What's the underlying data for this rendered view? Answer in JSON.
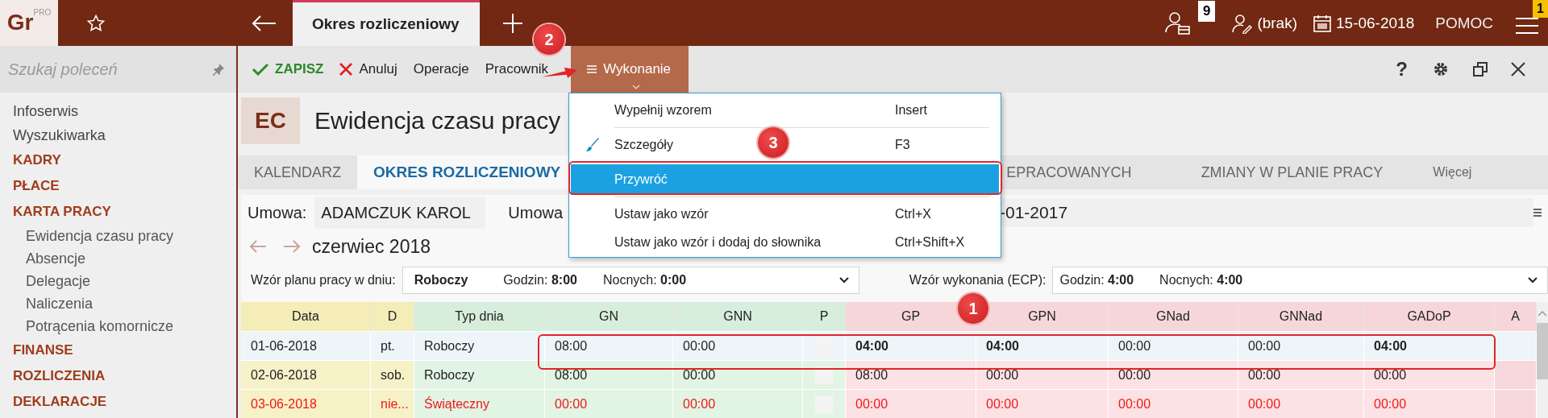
{
  "app": {
    "logo": "Gr",
    "logo_badge": "PRO"
  },
  "top_tabs": [
    {
      "label": "Okres rozliczeniowy",
      "selected": true
    }
  ],
  "top_right": {
    "notifications_badge": "9",
    "user": "(brak)",
    "date": "15-06-2018",
    "help": "POMOC",
    "menu_badge": "1"
  },
  "sidebar": {
    "search_placeholder": "Szukaj poleceń",
    "items": [
      {
        "label": "Infoserwis",
        "kind": "link"
      },
      {
        "label": "Wyszukiwarka",
        "kind": "link"
      },
      {
        "label": "KADRY",
        "kind": "section"
      },
      {
        "label": "PŁACE",
        "kind": "section"
      },
      {
        "label": "KARTA PRACY",
        "kind": "section",
        "children": [
          {
            "label": "Ewidencja czasu pracy"
          },
          {
            "label": "Absencje"
          },
          {
            "label": "Delegacje"
          },
          {
            "label": "Naliczenia"
          },
          {
            "label": "Potrącenia komornicze"
          }
        ]
      },
      {
        "label": "FINANSE",
        "kind": "section"
      },
      {
        "label": "ROZLICZENIA",
        "kind": "section"
      },
      {
        "label": "DEKLARACJE",
        "kind": "section"
      }
    ]
  },
  "toolbar": {
    "buttons": [
      {
        "label": "ZAPISZ",
        "kind": "save"
      },
      {
        "label": "Anuluj",
        "kind": "cancel"
      },
      {
        "label": "Operacje",
        "kind": "plain"
      },
      {
        "label": "Pracownik",
        "kind": "plain"
      },
      {
        "label": "Wykonanie",
        "kind": "menu",
        "expanded": true
      }
    ],
    "help": "?"
  },
  "dropdown": {
    "items": [
      {
        "label": "Wypełnij wzorem",
        "shortcut": "Insert",
        "kind": "plain",
        "selected": false,
        "separator_after": true
      },
      {
        "label": "Szczegóły",
        "shortcut": "F3",
        "kind": "brush",
        "selected": false,
        "separator_after": true
      },
      {
        "label": "Przywróć",
        "kind": "plain",
        "selected": true,
        "separator_after": true
      },
      {
        "label": "Ustaw jako wzór",
        "shortcut": "Ctrl+X",
        "kind": "plain",
        "selected": false,
        "separator_after": false
      },
      {
        "label": "Ustaw jako wzór i dodaj do słownika",
        "shortcut": "Ctrl+Shift+X",
        "kind": "plain",
        "selected": false,
        "separator_after": false
      }
    ]
  },
  "module": {
    "badge": "EC",
    "title": "Ewidencja czasu pracy"
  },
  "tabs": [
    {
      "label": "KALENDARZ",
      "kind": "tab",
      "selected": false
    },
    {
      "label": "OKRES ROZLICZENIOWY",
      "kind": "tab",
      "selected": true
    },
    {
      "label": "EPRACOWANYCH",
      "kind": "partial",
      "selected": false
    },
    {
      "label": "ZMIANY W PLANIE PRACY",
      "kind": "tab",
      "selected": false
    },
    {
      "label": "Więcej",
      "kind": "more",
      "selected": false
    }
  ],
  "contract": {
    "label": "Umowa:",
    "value": "ADAMCZUK KAROL",
    "label_2": "Umowa",
    "value_2": "-01-2017"
  },
  "month": {
    "label": "czerwiec 2018"
  },
  "plan_pattern": {
    "label": "Wzór planu pracy w dniu:",
    "day_type": "Roboczy",
    "hours_label": "Godzin:",
    "hours": "8:00",
    "night_label": "Nocnych:",
    "night": "0:00"
  },
  "exec_pattern": {
    "label": "Wzór wykonania (ECP):",
    "hours_label": "Godzin:",
    "hours": "4:00",
    "night_label": "Nocnych:",
    "night": "4:00"
  },
  "table": {
    "columns": [
      {
        "label": "Data",
        "kind": "date"
      },
      {
        "label": "D",
        "kind": "date"
      },
      {
        "label": "Typ dnia",
        "kind": "plan"
      },
      {
        "label": "GN",
        "kind": "plan"
      },
      {
        "label": "GNN",
        "kind": "plan"
      },
      {
        "label": "P",
        "kind": "plan"
      },
      {
        "label": "GP",
        "kind": "exec"
      },
      {
        "label": "GPN",
        "kind": "exec"
      },
      {
        "label": "GNad",
        "kind": "exec"
      },
      {
        "label": "GNNad",
        "kind": "exec"
      },
      {
        "label": "GADoP",
        "kind": "exec"
      },
      {
        "label": "A",
        "kind": "exec"
      }
    ],
    "rows": [
      {
        "selected": true,
        "holiday": false,
        "date": "01-06-2018",
        "day": "pt.",
        "day_type": "Roboczy",
        "checked": false,
        "plan": [
          {
            "text": "08:00",
            "bold": false
          },
          {
            "text": "00:00",
            "bold": false
          }
        ],
        "exec": [
          {
            "text": "04:00",
            "bold": true
          },
          {
            "text": "04:00",
            "bold": true
          },
          {
            "text": "00:00",
            "bold": false
          },
          {
            "text": "00:00",
            "bold": false
          },
          {
            "text": "04:00",
            "bold": true
          }
        ]
      },
      {
        "selected": false,
        "holiday": false,
        "date": "02-06-2018",
        "day": "sob.",
        "day_type": "Roboczy",
        "checked": false,
        "plan": [
          {
            "text": "08:00",
            "bold": false
          },
          {
            "text": "00:00",
            "bold": false
          }
        ],
        "exec": [
          {
            "text": "08:00",
            "bold": false
          },
          {
            "text": "00:00",
            "bold": false
          },
          {
            "text": "00:00",
            "bold": false
          },
          {
            "text": "00:00",
            "bold": false
          },
          {
            "text": "00:00",
            "bold": false
          }
        ]
      },
      {
        "selected": false,
        "holiday": true,
        "date": "03-06-2018",
        "day": "nie...",
        "day_type": "Świąteczny",
        "checked": false,
        "plan": [
          {
            "text": "00:00",
            "bold": false
          },
          {
            "text": "00:00",
            "bold": false
          }
        ],
        "exec": [
          {
            "text": "00:00",
            "bold": false
          },
          {
            "text": "00:00",
            "bold": false
          },
          {
            "text": "00:00",
            "bold": false
          },
          {
            "text": "00:00",
            "bold": false
          },
          {
            "text": "00:00",
            "bold": false
          }
        ]
      }
    ]
  },
  "annotations": [
    {
      "label": "2",
      "kind": "toolbar"
    },
    {
      "label": "3",
      "kind": "menu"
    },
    {
      "label": "1",
      "kind": "table"
    }
  ]
}
